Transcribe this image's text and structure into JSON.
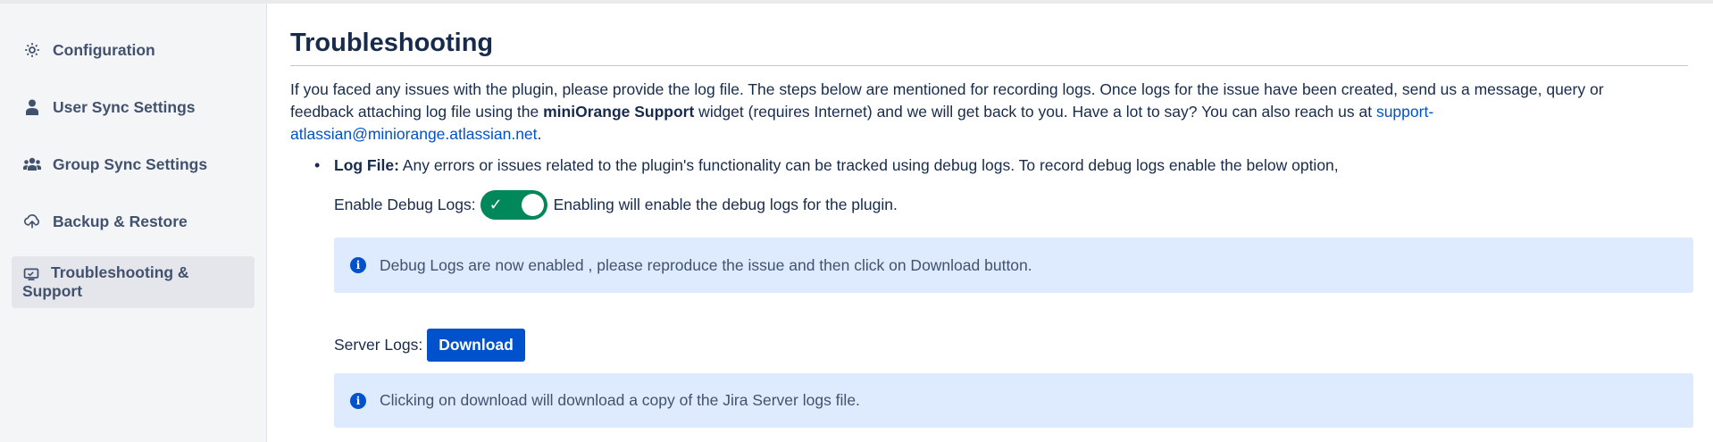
{
  "sidebar": {
    "items": [
      {
        "label": "Configuration",
        "icon": "gear-icon"
      },
      {
        "label": "User Sync Settings",
        "icon": "user-icon"
      },
      {
        "label": "Group Sync Settings",
        "icon": "users-icon"
      },
      {
        "label": "Backup & Restore",
        "icon": "cloud-upload-icon"
      },
      {
        "label": "Troubleshooting & Support",
        "icon": "monitor-icon",
        "active": true
      }
    ]
  },
  "main": {
    "title": "Troubleshooting",
    "intro": {
      "part1": "If you faced any issues with the plugin, please provide the log file. The steps below are mentioned for recording logs. Once logs for the issue have been created, send us a message, query or feedback attaching log file using the ",
      "bold": "miniOrange Support",
      "part2": " widget (requires Internet) and we will get back to you. Have a lot to say? You can also reach us at ",
      "email": "support-atlassian@miniorange.atlassian.net",
      "part3": "."
    },
    "log_file": {
      "label": "Log File:",
      "text": " Any errors or issues related to the plugin's functionality can be tracked using debug logs. To record debug logs enable the below option,"
    },
    "debug": {
      "label": "Enable Debug Logs:",
      "enabled": true,
      "hint": "Enabling will enable the debug logs for the plugin."
    },
    "debug_info": "Debug Logs are now enabled , please reproduce the issue and then click on Download button.",
    "server_logs": {
      "label": "Server Logs:",
      "button": "Download"
    },
    "download_info": "Clicking on download will download a copy of the Jira Server logs file."
  },
  "colors": {
    "accent": "#0052cc",
    "toggle_on": "#00875a",
    "info_bg": "#deebff",
    "sidebar_bg": "#f4f5f7"
  }
}
